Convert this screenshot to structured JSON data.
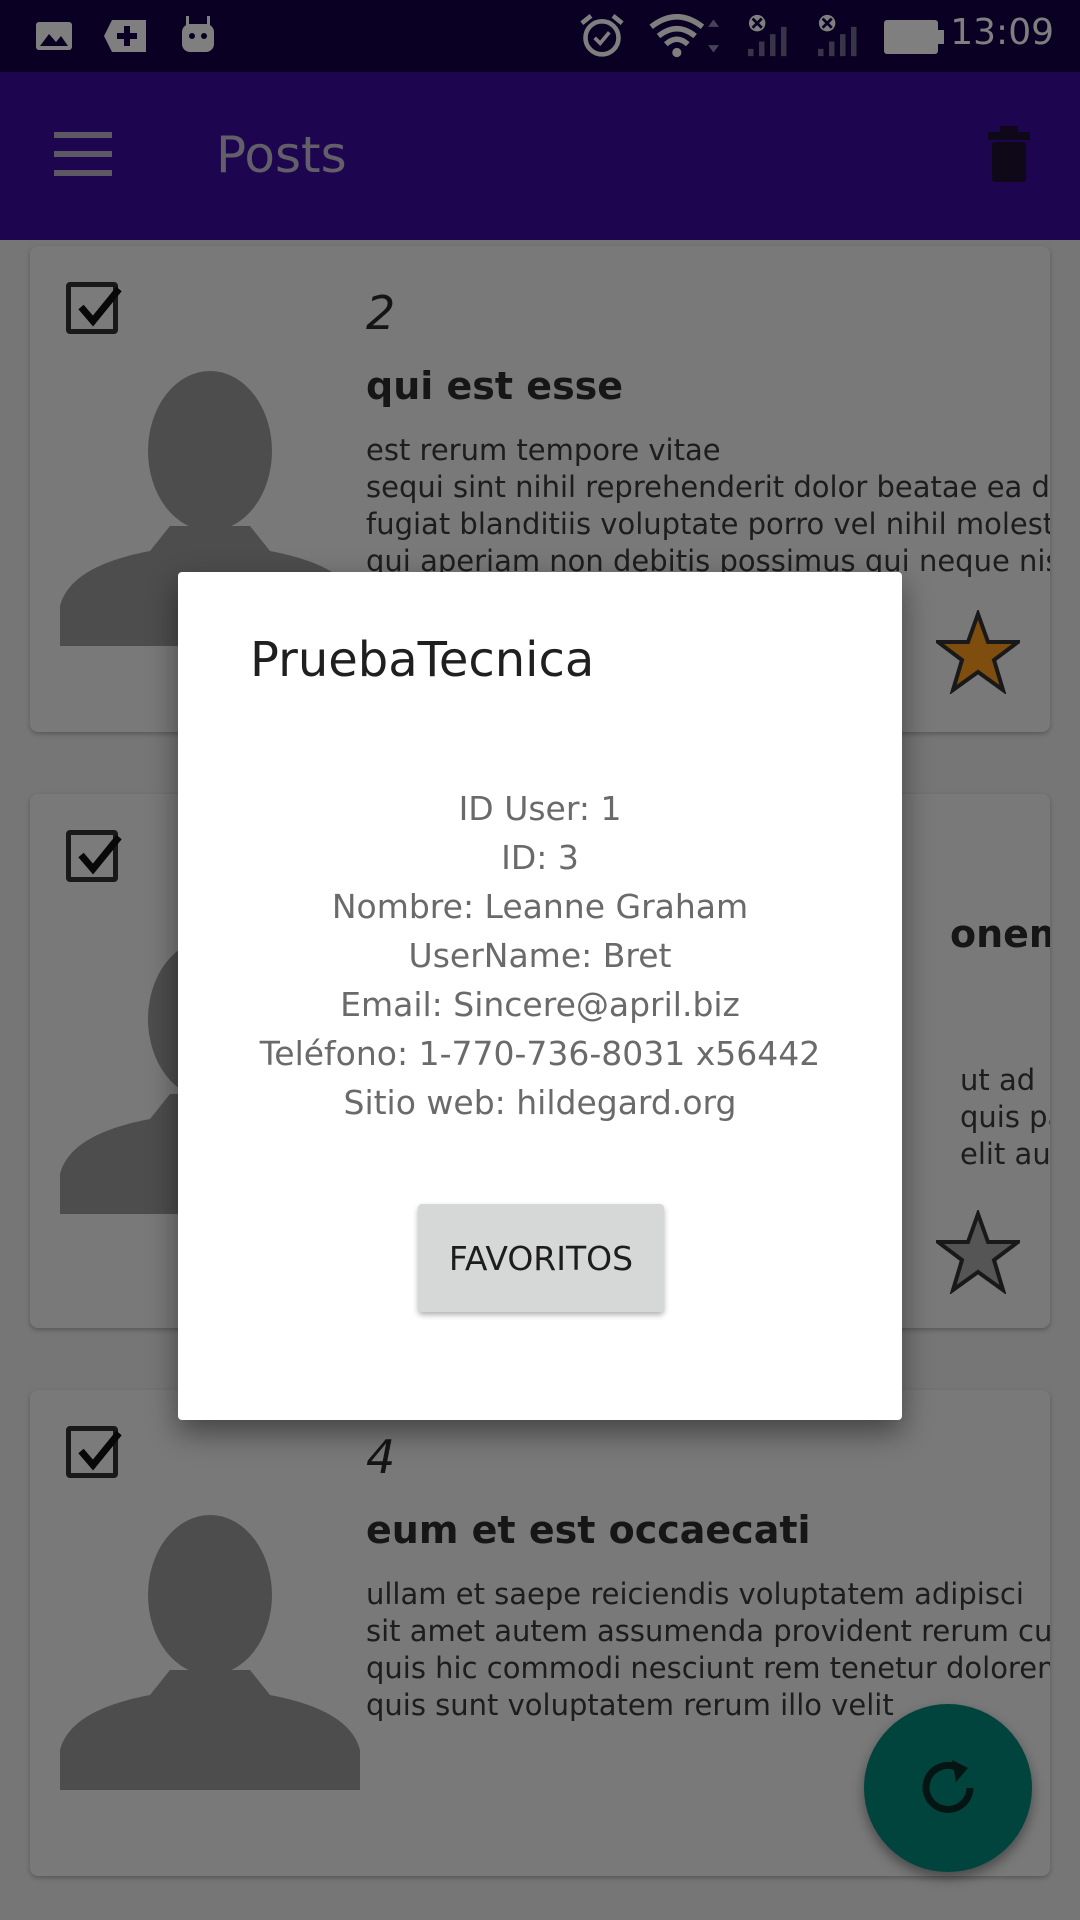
{
  "status_bar": {
    "time": "13:09",
    "icons": [
      "gallery-icon",
      "add-box-icon",
      "android-icon",
      "alarm-icon",
      "wifi-icon",
      "signal-icon",
      "signal-icon",
      "battery-icon"
    ]
  },
  "app_bar": {
    "title": "Posts",
    "menu_icon": "menu-icon",
    "delete_icon": "trash-icon"
  },
  "posts": [
    {
      "id": "2",
      "title": "qui est esse",
      "body": "est rerum tempore vitae\nsequi sint nihil reprehenderit dolor beatae ea dolores neque\nfugiat blanditiis voluptate porro vel nihil molestiae ut reiciendis\nqui aperiam non debitis possimus qui neque nisi nulla",
      "favorite": true
    },
    {
      "id": "3",
      "title": "ea molestias quasi exercitationem repellat qui ipsa sit aut",
      "title_visible": "onem re",
      "body_visible": "ut ad\nquis pari\nelit aut",
      "favorite": false
    },
    {
      "id": "4",
      "title": "eum et est occaecati",
      "body": "ullam et saepe reiciendis voluptatem adipisci\nsit amet autem assumenda provident rerum culpa\nquis hic commodi nesciunt rem tenetur doloremque ipsam iure\nquis sunt voluptatem rerum illo velit",
      "favorite": false
    }
  ],
  "dialog": {
    "title": "PruebaTecnica",
    "lines": [
      "ID User: 1",
      "ID: 3",
      "Nombre: Leanne Graham",
      "UserName: Bret",
      "Email: Sincere@april.biz",
      "Teléfono: 1-770-736-8031 x56442",
      "Sitio web: hildegard.org"
    ],
    "button_label": "FAVORITOS"
  },
  "fab": {
    "icon": "refresh-icon"
  },
  "colors": {
    "status_bar": "#140046",
    "app_bar": "#3b0aa0",
    "fab": "#00897b",
    "star_favorite": "#e07b00"
  }
}
